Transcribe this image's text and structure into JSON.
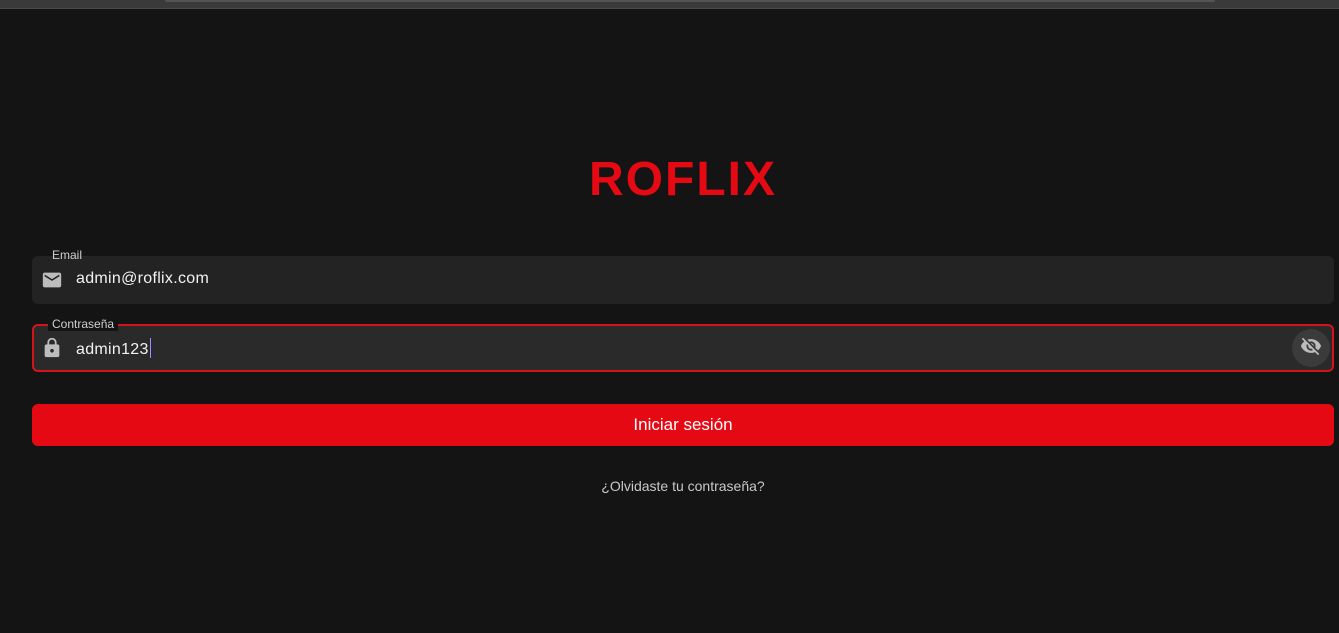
{
  "app": {
    "logo_text": "ROFLIX"
  },
  "form": {
    "email": {
      "label": "Email",
      "value": "admin@roflix.com",
      "icon": "mail-icon"
    },
    "password": {
      "label": "Contraseña",
      "value": "admin123",
      "icon": "lock-icon",
      "toggle_icon": "eye-off-icon"
    },
    "submit_label": "Iniciar sesión",
    "forgot_label": "¿Olvidaste tu contraseña?"
  },
  "colors": {
    "brand": "#e50914",
    "background": "#141414",
    "field_bg": "#232323",
    "focus_border": "#d5131b"
  }
}
